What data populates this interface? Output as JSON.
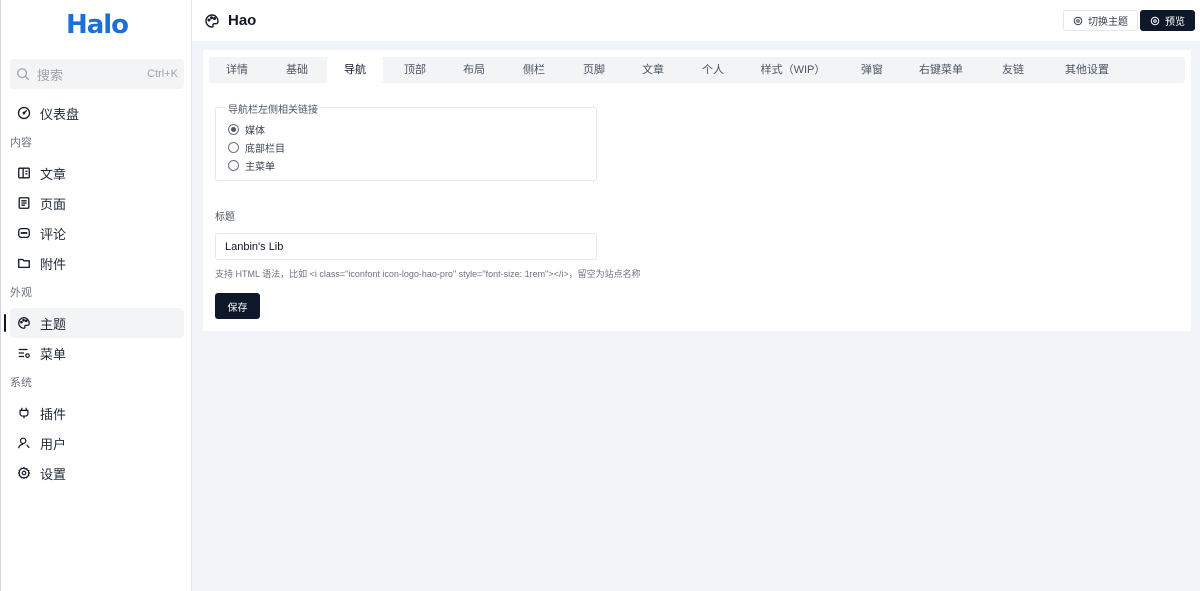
{
  "brand": {
    "logo_text": "Halo",
    "color": "#1d6fd8"
  },
  "search": {
    "placeholder": "搜索",
    "shortcut": "Ctrl+K"
  },
  "sidebar": {
    "dashboard": "仪表盘",
    "groups": {
      "content": "内容",
      "appearance": "外观",
      "system": "系统"
    },
    "items": {
      "posts": "文章",
      "pages": "页面",
      "comments": "评论",
      "attachments": "附件",
      "themes": "主题",
      "menus": "菜单",
      "plugins": "插件",
      "users": "用户",
      "settings": "设置"
    },
    "active": "themes"
  },
  "header": {
    "title": "Hao",
    "switch_theme_label": "切换主题",
    "preview_label": "预览"
  },
  "tabs": [
    {
      "label": "详情"
    },
    {
      "label": "基础"
    },
    {
      "label": "导航"
    },
    {
      "label": "顶部"
    },
    {
      "label": "布局"
    },
    {
      "label": "侧栏"
    },
    {
      "label": "页脚"
    },
    {
      "label": "文章"
    },
    {
      "label": "个人"
    },
    {
      "label": "样式（WIP）"
    },
    {
      "label": "弹窗"
    },
    {
      "label": "右键菜单"
    },
    {
      "label": "友链"
    },
    {
      "label": "其他设置"
    }
  ],
  "active_tab": "导航",
  "form": {
    "radio_group": {
      "legend": "导航栏左侧相关链接",
      "options": [
        "媒体",
        "底部栏目",
        "主菜单"
      ],
      "selected": "媒体"
    },
    "title_field": {
      "label": "标题",
      "value": "Lanbin's Lib",
      "help": "支持 HTML 语法，比如 <i class=\"iconfont icon-logo-hao-pro\" style=\"font-size: 1rem\"></i>，留空为站点名称"
    },
    "save_label": "保存"
  },
  "colors": {
    "primary_dark": "#0f172a",
    "page_bg": "#f1f5f9"
  }
}
